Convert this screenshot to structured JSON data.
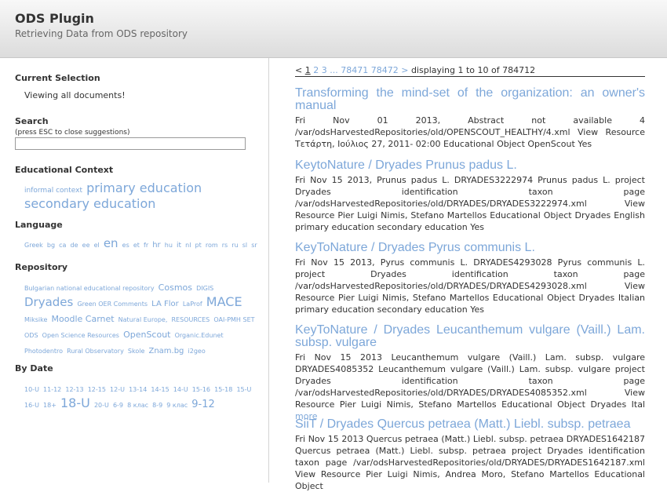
{
  "header": {
    "title": "ODS Plugin",
    "subtitle": "Retrieving Data from ODS repository"
  },
  "sidebar": {
    "current_selection": {
      "title": "Current Selection",
      "text": "Viewing all documents!"
    },
    "search": {
      "title": "Search",
      "hint": "(press ESC to close suggestions)",
      "value": ""
    },
    "educational_context": {
      "title": "Educational Context",
      "tags": [
        {
          "label": "informal context",
          "size": 9
        },
        {
          "label": "primary education",
          "size": 16
        },
        {
          "label": "secondary education",
          "size": 16
        }
      ]
    },
    "language": {
      "title": "Language",
      "tags": [
        {
          "label": "Greek",
          "size": 8
        },
        {
          "label": "bg",
          "size": 8
        },
        {
          "label": "ca",
          "size": 8
        },
        {
          "label": "de",
          "size": 8
        },
        {
          "label": "ee",
          "size": 8
        },
        {
          "label": "el",
          "size": 8
        },
        {
          "label": "en",
          "size": 15
        },
        {
          "label": "es",
          "size": 8
        },
        {
          "label": "et",
          "size": 8
        },
        {
          "label": "fr",
          "size": 8
        },
        {
          "label": "hr",
          "size": 10
        },
        {
          "label": "hu",
          "size": 8
        },
        {
          "label": "it",
          "size": 9
        },
        {
          "label": "nl",
          "size": 8
        },
        {
          "label": "pt",
          "size": 8
        },
        {
          "label": "rom",
          "size": 8
        },
        {
          "label": "rs",
          "size": 8
        },
        {
          "label": "ru",
          "size": 8
        },
        {
          "label": "sl",
          "size": 8
        },
        {
          "label": "sr",
          "size": 8
        }
      ]
    },
    "repository": {
      "title": "Repository",
      "tags": [
        {
          "label": "Bulgarian national educational repository",
          "size": 8
        },
        {
          "label": "Cosmos",
          "size": 11
        },
        {
          "label": "DIGIS",
          "size": 8
        },
        {
          "label": "Dryades",
          "size": 15
        },
        {
          "label": "Green OER Comments",
          "size": 8
        },
        {
          "label": "LA Flor",
          "size": 10
        },
        {
          "label": "LaProf",
          "size": 8
        },
        {
          "label": "MACE",
          "size": 16
        },
        {
          "label": "Miksike",
          "size": 8
        },
        {
          "label": "Moodle Carnet",
          "size": 11
        },
        {
          "label": "Natural Europe,",
          "size": 8
        },
        {
          "label": "RESOURCES",
          "size": 8
        },
        {
          "label": "OAI-PMH SET ODS",
          "size": 8
        },
        {
          "label": "Open Science Resources",
          "size": 8
        },
        {
          "label": "OpenScout",
          "size": 11
        },
        {
          "label": "Organic.Edunet",
          "size": 8
        },
        {
          "label": "Photodentro",
          "size": 8
        },
        {
          "label": "Rural Observatory",
          "size": 8
        },
        {
          "label": "Skole",
          "size": 8
        },
        {
          "label": "Znam.bg",
          "size": 10
        },
        {
          "label": "i2geo",
          "size": 8
        }
      ]
    },
    "by_date": {
      "title": "By Date",
      "tags": [
        {
          "label": "10-U",
          "size": 8
        },
        {
          "label": "11-12",
          "size": 8
        },
        {
          "label": "12-13",
          "size": 8
        },
        {
          "label": "12-15",
          "size": 8
        },
        {
          "label": "12-U",
          "size": 8
        },
        {
          "label": "13-14",
          "size": 8
        },
        {
          "label": "14-15",
          "size": 8
        },
        {
          "label": "14-U",
          "size": 8
        },
        {
          "label": "15-16",
          "size": 8
        },
        {
          "label": "15-18",
          "size": 8
        },
        {
          "label": "15-U",
          "size": 8
        },
        {
          "label": "16-U",
          "size": 8
        },
        {
          "label": "18+",
          "size": 8
        },
        {
          "label": "18-U",
          "size": 16
        },
        {
          "label": "20-U",
          "size": 8
        },
        {
          "label": "6-9",
          "size": 8
        },
        {
          "label": "8 клас",
          "size": 8
        },
        {
          "label": "8-9",
          "size": 8
        },
        {
          "label": "9 клас",
          "size": 8
        },
        {
          "label": "9-12",
          "size": 13
        }
      ]
    }
  },
  "pager": {
    "prev": "<",
    "pages": [
      {
        "label": "1",
        "current": true
      },
      {
        "label": "2",
        "current": false
      },
      {
        "label": "3",
        "current": false
      }
    ],
    "ellipsis": "...",
    "last_pages": [
      "78471",
      "78472"
    ],
    "next": ">",
    "status": "displaying 1 to 10 of 784712"
  },
  "results": [
    {
      "title": "Transforming the mind-set of the organization: an owner's manual",
      "description": "Fri Nov 01 2013, Abstract not available 4 /var/odsHarvestedRepositories/old/OPENSCOUT_HEALTHY/4.xml View Resource Τετάρτη, Ιούλιος 27, 2011- 02:00 Educational Object OpenScout Yes",
      "more": ""
    },
    {
      "title": "KeytoNature / Dryades Prunus padus L.",
      "description": "Fri Nov 15 2013, Prunus padus L. DRYADES3222974 Prunus padus L. project Dryades identification taxon page /var/odsHarvestedRepositories/old/DRYADES/DRYADES3222974.xml View Resource Pier Luigi Nimis, Stefano Martellos Educational Object Dryades English primary education secondary education Yes",
      "more": ""
    },
    {
      "title": "KeyToNature / Dryades Pyrus communis L.",
      "description": "Fri Nov 15 2013, Pyrus communis L. DRYADES4293028 Pyrus communis L. project Dryades identification taxon page /var/odsHarvestedRepositories/old/DRYADES/DRYADES4293028.xml View Resource Pier Luigi Nimis, Stefano Martellos Educational Object Dryades Italian primary education secondary education Yes",
      "more": ""
    },
    {
      "title": "KeyToNature / Dryades Leucanthemum vulgare (Vaill.) Lam. subsp. vulgare",
      "description": "Fri Nov 15 2013 Leucanthemum vulgare (Vaill.) Lam. subsp. vulgare DRYADES4085352 Leucanthemum vulgare (Vaill.) Lam. subsp. vulgare project Dryades identification taxon page /var/odsHarvestedRepositories/old/DRYADES/DRYADES4085352.xml View Resource Pier Luigi Nimis, Stefano Martellos Educational Object Dryades Ital",
      "more": "more"
    },
    {
      "title": "SiiT / Dryades Quercus petraea (Matt.) Liebl. subsp. petraea",
      "description": "Fri Nov 15 2013 Quercus petraea (Matt.) Liebl. subsp. petraea DRYADES1642187 Quercus petraea (Matt.) Liebl. subsp. petraea project Dryades identification taxon page /var/odsHarvestedRepositories/old/DRYADES/DRYADES1642187.xml View Resource Pier Luigi Nimis, Andrea Moro, Stefano Martellos Educational Object",
      "more": ""
    }
  ]
}
